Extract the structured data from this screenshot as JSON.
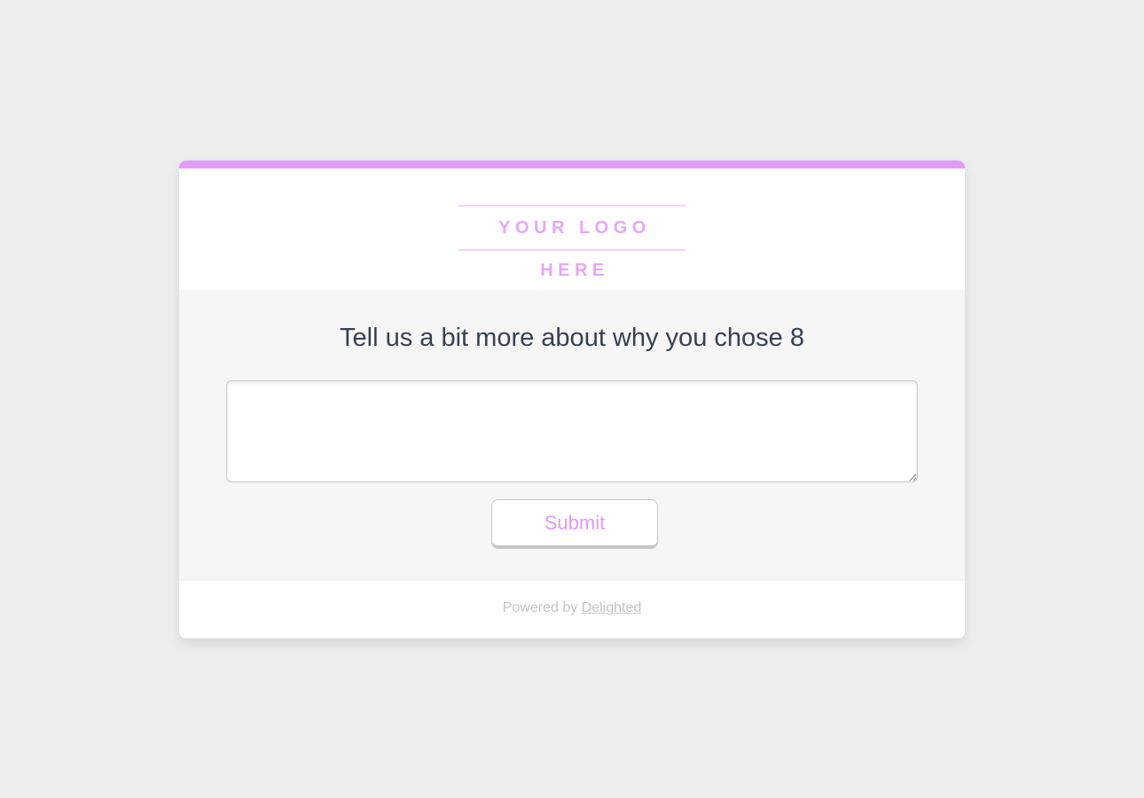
{
  "brand": {
    "accent_color": "#e19cf7",
    "logo_text": "YOUR LOGO HERE"
  },
  "survey": {
    "question": "Tell us a bit more about why you chose 8",
    "comment": {
      "value": "",
      "placeholder": ""
    },
    "submit_label": "Submit"
  },
  "footer": {
    "powered_prefix": "Powered by",
    "link_text": "Delighted"
  }
}
